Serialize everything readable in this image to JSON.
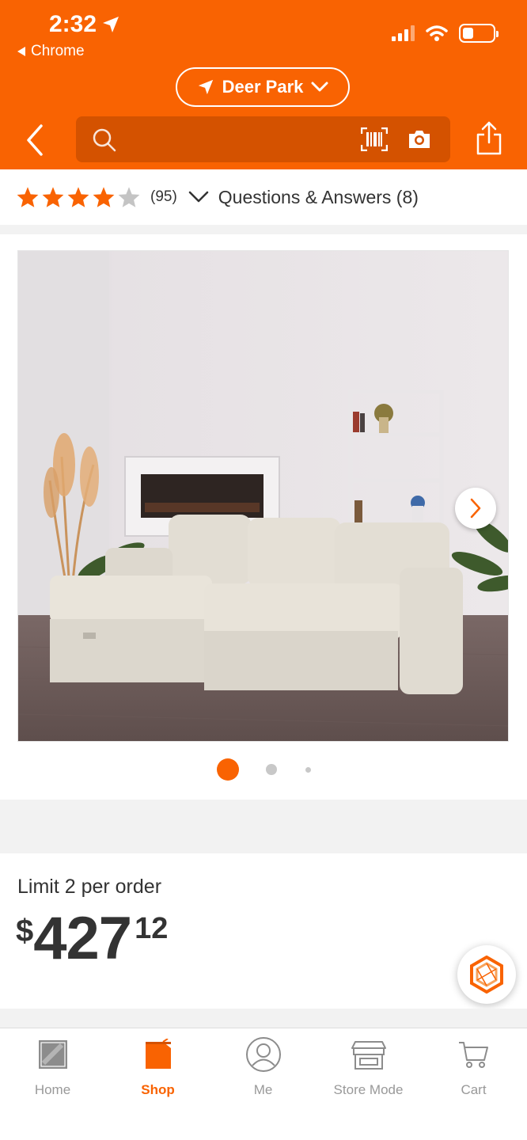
{
  "status_bar": {
    "time": "2:32",
    "back_app": "Chrome"
  },
  "header": {
    "store_location": "Deer Park",
    "search": {
      "placeholder": ""
    }
  },
  "rating": {
    "stars": 4,
    "max_stars": 5,
    "review_count": "(95)",
    "qa_label": "Questions & Answers (8)"
  },
  "gallery": {
    "image_count": 3,
    "active_index": 0
  },
  "price_card": {
    "limit": "Limit 2 per order",
    "currency": "$",
    "dollars": "427",
    "cents": "12"
  },
  "tabbar": {
    "items": [
      {
        "label": "Home",
        "icon": "home-depot-logo-icon"
      },
      {
        "label": "Shop",
        "icon": "shop-icon"
      },
      {
        "label": "Me",
        "icon": "user-icon"
      },
      {
        "label": "Store Mode",
        "icon": "store-icon"
      },
      {
        "label": "Cart",
        "icon": "cart-icon"
      }
    ],
    "active": "Shop"
  },
  "colors": {
    "brand_orange": "#f96302",
    "search_bg": "#d45200",
    "star_color": "#f96302",
    "text": "#333333",
    "inactive_tab": "#999999"
  }
}
